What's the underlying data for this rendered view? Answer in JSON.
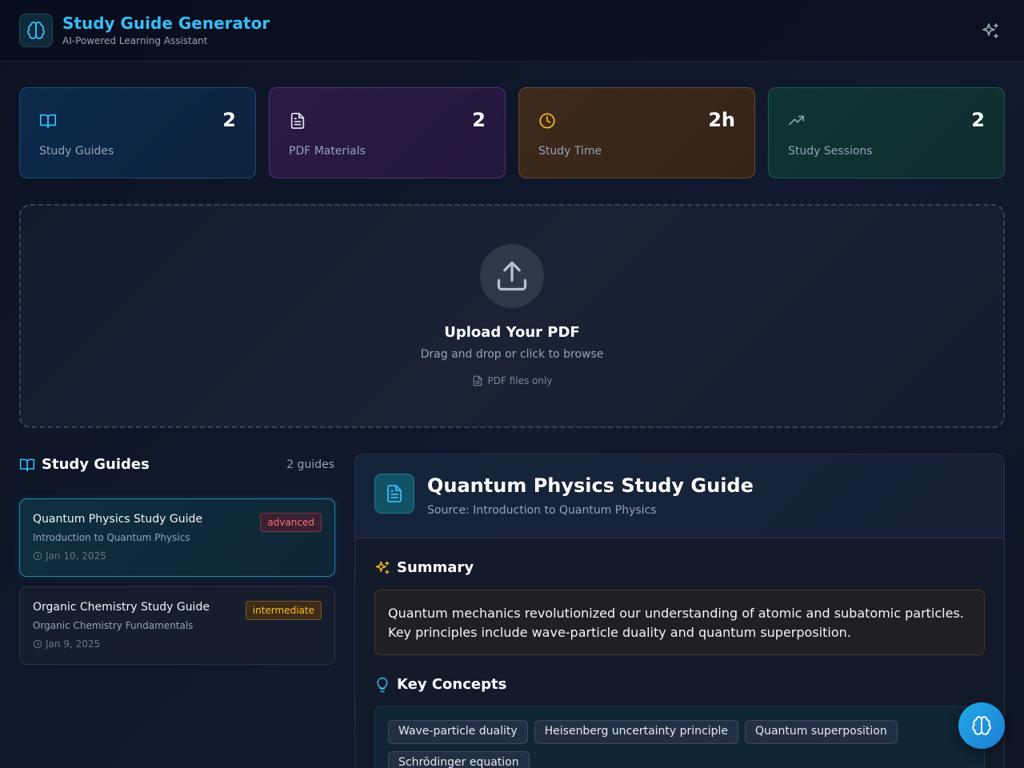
{
  "app": {
    "title": "Study Guide Generator",
    "subtitle": "AI-Powered Learning Assistant"
  },
  "stats": [
    {
      "value": "2",
      "label": "Study Guides",
      "icon": "book-open-icon"
    },
    {
      "value": "2",
      "label": "PDF Materials",
      "icon": "file-text-icon"
    },
    {
      "value": "2h",
      "label": "Study Time",
      "icon": "clock-icon"
    },
    {
      "value": "2",
      "label": "Study Sessions",
      "icon": "trending-up-icon"
    }
  ],
  "upload": {
    "title": "Upload Your PDF",
    "subtitle": "Drag and drop or click to browse",
    "note": "PDF files only"
  },
  "guides": {
    "heading": "Study Guides",
    "count": "2 guides",
    "items": [
      {
        "title": "Quantum Physics Study Guide",
        "source": "Introduction to Quantum Physics",
        "date": "Jan 10, 2025",
        "level": "advanced"
      },
      {
        "title": "Organic Chemistry Study Guide",
        "source": "Organic Chemistry Fundamentals",
        "date": "Jan 9, 2025",
        "level": "intermediate"
      }
    ]
  },
  "detail": {
    "title": "Quantum Physics Study Guide",
    "source": "Source: Introduction to Quantum Physics",
    "summary_heading": "Summary",
    "summary": "Quantum mechanics revolutionized our understanding of atomic and subatomic particles. Key principles include wave-particle duality and quantum superposition.",
    "concepts_heading": "Key Concepts",
    "concepts": [
      "Wave-particle duality",
      "Heisenberg uncertainty principle",
      "Quantum superposition",
      "Schrödinger equation"
    ]
  },
  "colors": {
    "accent": "#38bdf8",
    "advanced": "#f87171",
    "intermediate": "#fbbf24",
    "sparkle": "#fbbf24"
  }
}
